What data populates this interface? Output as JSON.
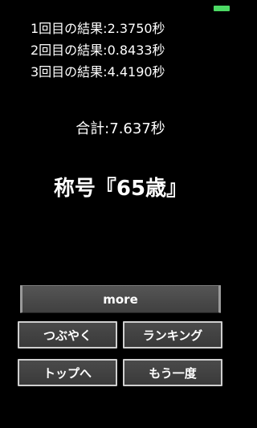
{
  "status_bar": {
    "battery_color": "#4cd964"
  },
  "results": [
    {
      "label": "1回目の結果:2.3750秒"
    },
    {
      "label": "2回目の結果:0.8433秒"
    },
    {
      "label": "3回目の結果:4.4190秒"
    }
  ],
  "total": "合計:7.637秒",
  "title": "称号『65歳』",
  "buttons": {
    "more": "more",
    "tweet": "つぶやく",
    "ranking": "ランキング",
    "top": "トップへ",
    "retry": "もう一度"
  }
}
